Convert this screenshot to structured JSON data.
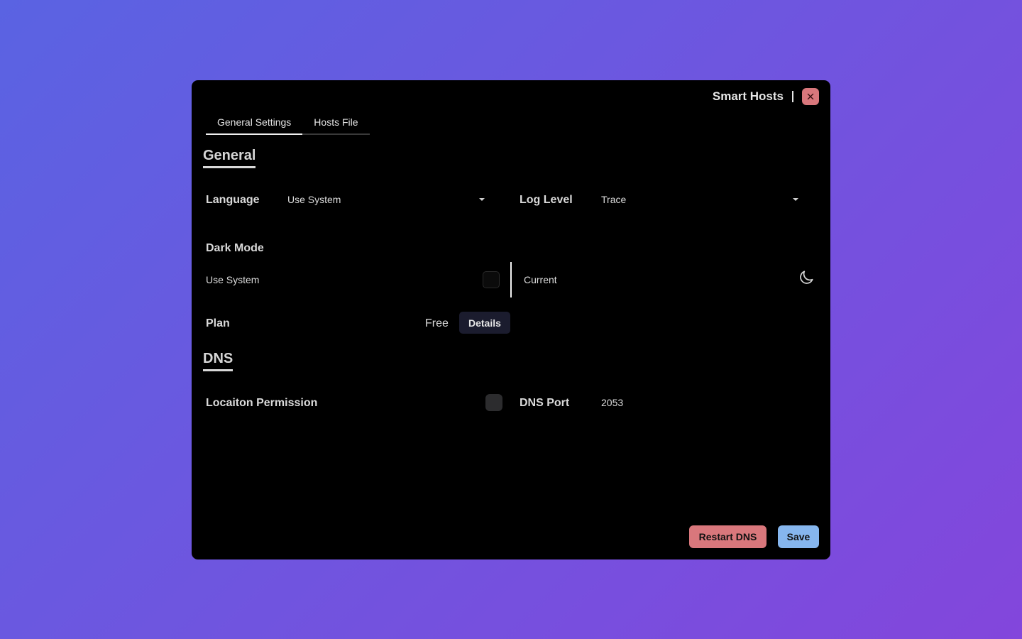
{
  "app": {
    "title": "Smart Hosts"
  },
  "tabs": [
    {
      "label": "General Settings",
      "active": true
    },
    {
      "label": "Hosts File",
      "active": false
    }
  ],
  "general": {
    "heading": "General",
    "language": {
      "label": "Language",
      "value": "Use System"
    },
    "log_level": {
      "label": "Log Level",
      "value": "Trace"
    },
    "dark_mode": {
      "label": "Dark Mode",
      "use_system_label": "Use System",
      "use_system_checked": false,
      "current_label": "Current",
      "current_icon": "moon-icon"
    },
    "plan": {
      "label": "Plan",
      "value": "Free",
      "details_label": "Details"
    }
  },
  "dns": {
    "heading": "DNS",
    "location_permission": {
      "label": "Locaiton Permission",
      "checked": false
    },
    "port": {
      "label": "DNS Port",
      "value": "2053"
    }
  },
  "actions": {
    "restart_label": "Restart DNS",
    "save_label": "Save"
  },
  "colors": {
    "restart": "#d9777c",
    "save": "#86b6ee",
    "close": "#d9777c",
    "details_bg": "#1b1c2e"
  }
}
